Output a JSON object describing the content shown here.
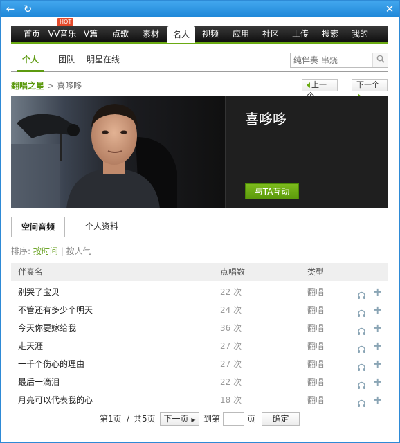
{
  "titlebar": {
    "back_icon": "back-arrow-icon",
    "refresh_icon": "refresh-icon",
    "close_icon": "close-icon"
  },
  "nav": {
    "items": [
      "首页",
      "VV音乐",
      "V篇",
      "点歌",
      "素材",
      "名人",
      "视频",
      "应用",
      "社区",
      "上传",
      "搜索",
      "我的"
    ],
    "active_index": 5,
    "hot_badge": "HOT"
  },
  "subnav": {
    "tabs": [
      "个人",
      "团队",
      "明星在线"
    ],
    "active_index": 0,
    "search_placeholder": "纯伴奏 串烧"
  },
  "breadcrumb": {
    "root": "翻唱之星",
    "separator": ">",
    "current": "喜哆哆"
  },
  "pager": {
    "prev": "上一个",
    "next": "下一个"
  },
  "profile": {
    "name": "喜哆哆",
    "interact_button": "与TA互动"
  },
  "content_tabs": [
    "空间音频",
    "个人资料"
  ],
  "sort": {
    "label": "排序:",
    "by_time": "按时间",
    "separator": "|",
    "by_popularity": "按人气"
  },
  "table": {
    "headers": [
      "伴奏名",
      "点唱数",
      "类型"
    ],
    "rows": [
      {
        "name": "别哭了宝贝",
        "plays": "22 次",
        "type": "翻唱"
      },
      {
        "name": "不管还有多少个明天",
        "plays": "24 次",
        "type": "翻唱"
      },
      {
        "name": "今天你要嫁给我",
        "plays": "36 次",
        "type": "翻唱"
      },
      {
        "name": "走天涯",
        "plays": "27 次",
        "type": "翻唱"
      },
      {
        "name": "一千个伤心的理由",
        "plays": "27 次",
        "type": "翻唱"
      },
      {
        "name": "最后一滴泪",
        "plays": "22 次",
        "type": "翻唱"
      },
      {
        "name": "月亮可以代表我的心",
        "plays": "18 次",
        "type": "翻唱"
      }
    ]
  },
  "pagination": {
    "current_page": "第1页",
    "separator": "/",
    "total": "共5页",
    "next": "下一页",
    "goto_label": "到第",
    "page_unit": "页",
    "confirm": "确定"
  },
  "colors": {
    "accent_green": "#5d9a10",
    "titlebar_blue": "#1e87d8",
    "nav_dark": "#1a1a1a"
  }
}
